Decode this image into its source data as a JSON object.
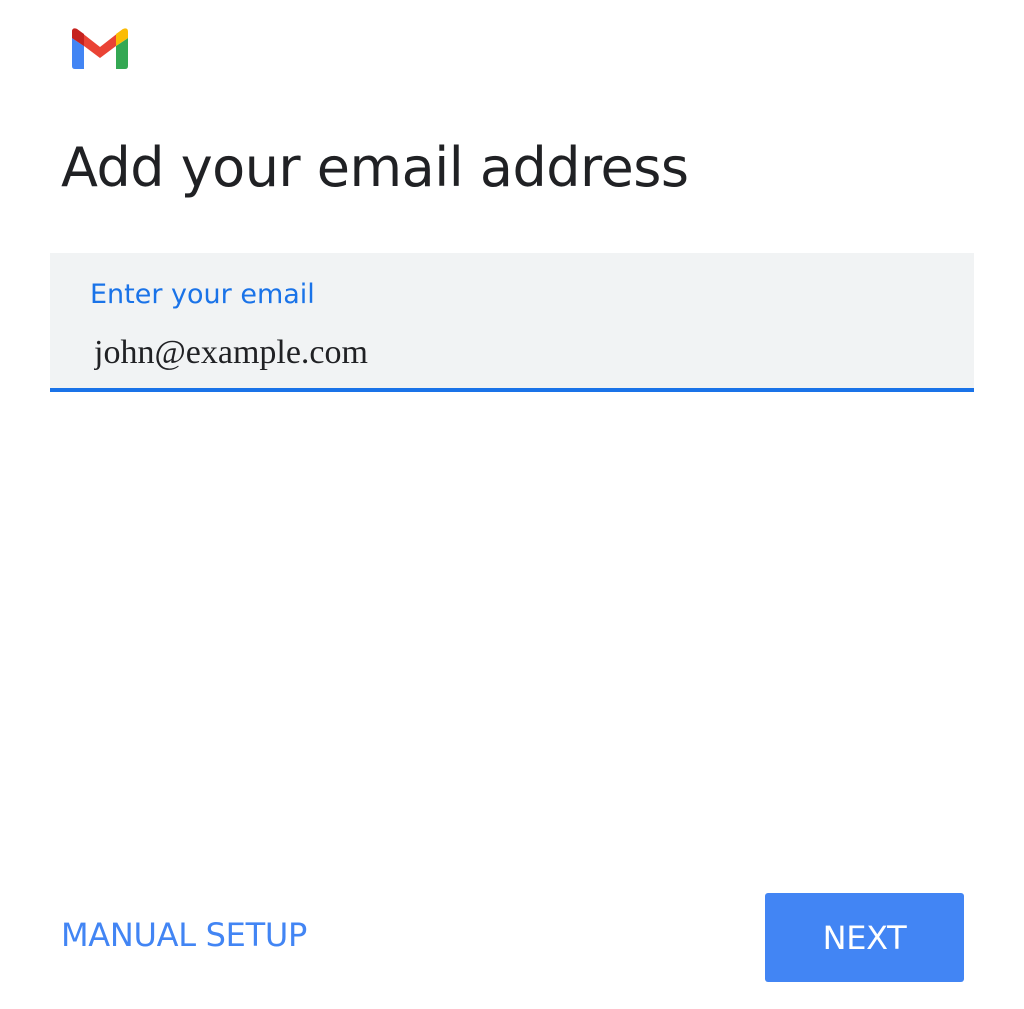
{
  "app": {
    "logo_icon": "gmail-logo-icon",
    "logo_colors": {
      "red": "#ea4335",
      "blue": "#4285f4",
      "green": "#34a853",
      "yellow": "#fbbc04",
      "dark_red": "#c5221f"
    }
  },
  "page": {
    "title": "Add your email address"
  },
  "email_field": {
    "label": "Enter your email",
    "value": "john@example.com",
    "accent_color": "#1a73e8"
  },
  "actions": {
    "manual_setup_label": "MANUAL SETUP",
    "next_label": "NEXT",
    "button_color": "#4285f4"
  }
}
